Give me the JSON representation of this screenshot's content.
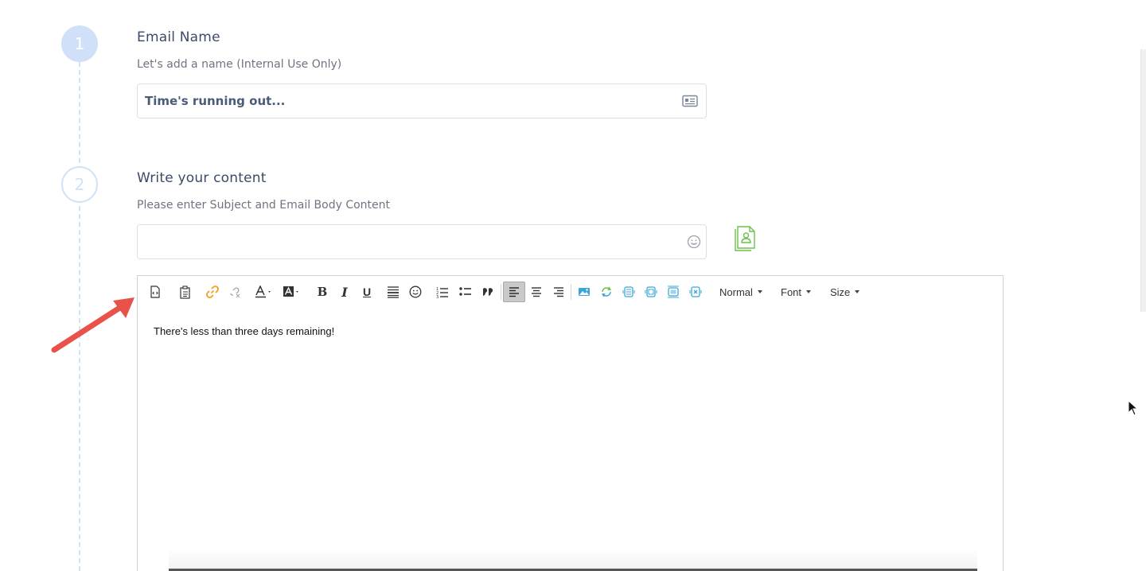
{
  "steps": [
    {
      "number": "1",
      "title": "Email Name",
      "subtitle": "Let's add a name (Internal Use Only)"
    },
    {
      "number": "2",
      "title": "Write your content",
      "subtitle": "Please enter Subject and Email Body Content"
    }
  ],
  "email_name": {
    "value": "Time's running out...",
    "icon": "id-card-icon"
  },
  "subject": {
    "value": "",
    "placeholder": "",
    "icon": "emoji-icon"
  },
  "contact_button": {
    "icon": "contact-document-icon",
    "color": "#6cc04a"
  },
  "toolbar": {
    "icons": [
      "source-icon",
      "paste-icon",
      "link-icon",
      "unlink-icon",
      "text-color-icon",
      "background-color-icon",
      "bold-icon",
      "italic-icon",
      "underline-icon",
      "horizontal-rule-icon",
      "emoji-icon",
      "numbered-list-icon",
      "bulleted-list-icon",
      "blockquote-icon",
      "align-left-icon",
      "align-center-icon",
      "align-right-icon",
      "image-icon",
      "sync-icon",
      "block-1-icon",
      "block-2-icon",
      "block-3-icon",
      "block-4-icon"
    ],
    "bold_label": "B",
    "italic_label": "I",
    "underline_label": "U",
    "format_dropdown": "Normal",
    "font_dropdown": "Font",
    "size_dropdown": "Size",
    "active_alignment": "left"
  },
  "editor": {
    "body_text": "There's less than three days remaining!"
  },
  "colors": {
    "link_icon": "#f0a020",
    "media_icons": "#3aa6d8",
    "annotation_arrow": "#e8524a",
    "step_active": "#cfe0f8",
    "title_text": "#3c4a66"
  }
}
